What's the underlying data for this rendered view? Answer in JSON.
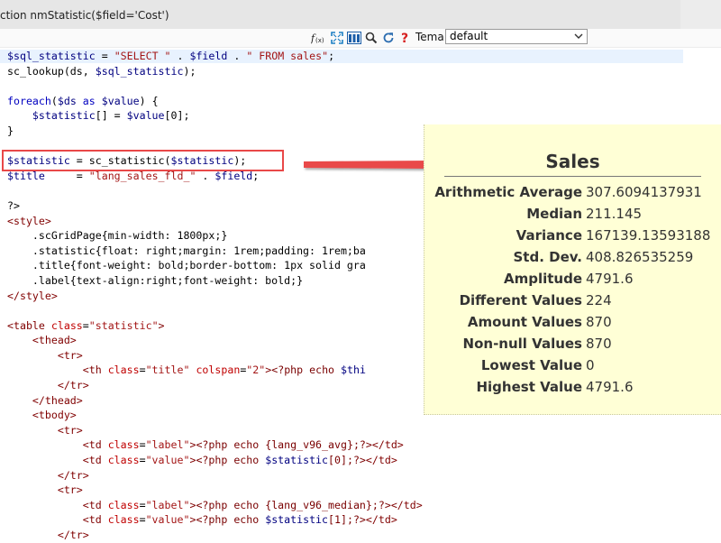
{
  "window": {
    "title": "ction nmStatistic($field='Cost')"
  },
  "toolbar": {
    "tema_label": "Tema",
    "tema_value": "default",
    "icons": [
      "fx-icon",
      "fullscreen-icon",
      "layout-icon",
      "search-icon",
      "refresh-icon",
      "help-icon"
    ]
  },
  "code_lines": [
    [
      {
        "t": "var",
        "v": "$sql_statistic"
      },
      {
        "t": "plain",
        "v": " = "
      },
      {
        "t": "str",
        "v": "\"SELECT \""
      },
      {
        "t": "plain",
        "v": " . "
      },
      {
        "t": "var",
        "v": "$field"
      },
      {
        "t": "plain",
        "v": " . "
      },
      {
        "t": "str",
        "v": "\" FROM sales\""
      },
      {
        "t": "plain",
        "v": ";"
      }
    ],
    [
      {
        "t": "plain",
        "v": "sc_lookup(ds, "
      },
      {
        "t": "var",
        "v": "$sql_statistic"
      },
      {
        "t": "plain",
        "v": ");"
      }
    ],
    [],
    [
      {
        "t": "kw",
        "v": "foreach"
      },
      {
        "t": "plain",
        "v": "("
      },
      {
        "t": "var",
        "v": "$ds"
      },
      {
        "t": "plain",
        "v": " "
      },
      {
        "t": "kw",
        "v": "as"
      },
      {
        "t": "plain",
        "v": " "
      },
      {
        "t": "var",
        "v": "$value"
      },
      {
        "t": "plain",
        "v": ") {"
      }
    ],
    [
      {
        "t": "plain",
        "v": "    "
      },
      {
        "t": "var",
        "v": "$statistic"
      },
      {
        "t": "plain",
        "v": "[] = "
      },
      {
        "t": "var",
        "v": "$value"
      },
      {
        "t": "plain",
        "v": "[0];"
      }
    ],
    [
      {
        "t": "plain",
        "v": "}"
      }
    ],
    [],
    [
      {
        "t": "var",
        "v": "$statistic"
      },
      {
        "t": "plain",
        "v": " = sc_statistic("
      },
      {
        "t": "var",
        "v": "$statistic"
      },
      {
        "t": "plain",
        "v": ");"
      }
    ],
    [
      {
        "t": "var",
        "v": "$title"
      },
      {
        "t": "plain",
        "v": "     = "
      },
      {
        "t": "str",
        "v": "\"lang_sales_fld_\""
      },
      {
        "t": "plain",
        "v": " . "
      },
      {
        "t": "var",
        "v": "$field"
      },
      {
        "t": "plain",
        "v": ";"
      }
    ],
    [],
    [
      {
        "t": "plain",
        "v": "?>"
      }
    ],
    [
      {
        "t": "tag",
        "v": "<style>"
      }
    ],
    [
      {
        "t": "plain",
        "v": "    .scGridPage{min-width: 1800px;}"
      }
    ],
    [
      {
        "t": "plain",
        "v": "    .statistic{float: right;margin: 1rem;padding: 1rem;ba"
      }
    ],
    [
      {
        "t": "plain",
        "v": "    .title{font-weight: bold;border-bottom: 1px solid gra"
      }
    ],
    [
      {
        "t": "plain",
        "v": "    .label{text-align:right;font-weight: bold;}"
      }
    ],
    [
      {
        "t": "tag",
        "v": "</style>"
      }
    ],
    [],
    [
      {
        "t": "tag",
        "v": "<table "
      },
      {
        "t": "attr",
        "v": "class"
      },
      {
        "t": "plain",
        "v": "="
      },
      {
        "t": "str",
        "v": "\"statistic\""
      },
      {
        "t": "tag",
        "v": ">"
      }
    ],
    [
      {
        "t": "plain",
        "v": "    "
      },
      {
        "t": "tag",
        "v": "<thead>"
      }
    ],
    [
      {
        "t": "plain",
        "v": "        "
      },
      {
        "t": "tag",
        "v": "<tr>"
      }
    ],
    [
      {
        "t": "plain",
        "v": "            "
      },
      {
        "t": "tag",
        "v": "<th "
      },
      {
        "t": "attr",
        "v": "class"
      },
      {
        "t": "plain",
        "v": "="
      },
      {
        "t": "str",
        "v": "\"title\""
      },
      {
        "t": "plain",
        "v": " "
      },
      {
        "t": "attr",
        "v": "colspan"
      },
      {
        "t": "plain",
        "v": "="
      },
      {
        "t": "str",
        "v": "\"2\""
      },
      {
        "t": "tag",
        "v": ">"
      },
      {
        "t": "php",
        "v": "<?php echo "
      },
      {
        "t": "var",
        "v": "$thi"
      }
    ],
    [
      {
        "t": "plain",
        "v": "        "
      },
      {
        "t": "tag",
        "v": "</tr>"
      }
    ],
    [
      {
        "t": "plain",
        "v": "    "
      },
      {
        "t": "tag",
        "v": "</thead>"
      }
    ],
    [
      {
        "t": "plain",
        "v": "    "
      },
      {
        "t": "tag",
        "v": "<tbody>"
      }
    ],
    [
      {
        "t": "plain",
        "v": "        "
      },
      {
        "t": "tag",
        "v": "<tr>"
      }
    ],
    [
      {
        "t": "plain",
        "v": "            "
      },
      {
        "t": "tag",
        "v": "<td "
      },
      {
        "t": "attr",
        "v": "class"
      },
      {
        "t": "plain",
        "v": "="
      },
      {
        "t": "str",
        "v": "\"label\""
      },
      {
        "t": "tag",
        "v": ">"
      },
      {
        "t": "php",
        "v": "<?php echo {lang_v96_avg};?>"
      },
      {
        "t": "tag",
        "v": "</td>"
      }
    ],
    [
      {
        "t": "plain",
        "v": "            "
      },
      {
        "t": "tag",
        "v": "<td "
      },
      {
        "t": "attr",
        "v": "class"
      },
      {
        "t": "plain",
        "v": "="
      },
      {
        "t": "str",
        "v": "\"value\""
      },
      {
        "t": "tag",
        "v": ">"
      },
      {
        "t": "php",
        "v": "<?php echo "
      },
      {
        "t": "var",
        "v": "$statistic"
      },
      {
        "t": "php",
        "v": "[0];?>"
      },
      {
        "t": "tag",
        "v": "</td>"
      }
    ],
    [
      {
        "t": "plain",
        "v": "        "
      },
      {
        "t": "tag",
        "v": "</tr>"
      }
    ],
    [
      {
        "t": "plain",
        "v": "        "
      },
      {
        "t": "tag",
        "v": "<tr>"
      }
    ],
    [
      {
        "t": "plain",
        "v": "            "
      },
      {
        "t": "tag",
        "v": "<td "
      },
      {
        "t": "attr",
        "v": "class"
      },
      {
        "t": "plain",
        "v": "="
      },
      {
        "t": "str",
        "v": "\"label\""
      },
      {
        "t": "tag",
        "v": ">"
      },
      {
        "t": "php",
        "v": "<?php echo {lang_v96_median};?>"
      },
      {
        "t": "tag",
        "v": "</td>"
      }
    ],
    [
      {
        "t": "plain",
        "v": "            "
      },
      {
        "t": "tag",
        "v": "<td "
      },
      {
        "t": "attr",
        "v": "class"
      },
      {
        "t": "plain",
        "v": "="
      },
      {
        "t": "str",
        "v": "\"value\""
      },
      {
        "t": "tag",
        "v": ">"
      },
      {
        "t": "php",
        "v": "<?php echo "
      },
      {
        "t": "var",
        "v": "$statistic"
      },
      {
        "t": "php",
        "v": "[1];?>"
      },
      {
        "t": "tag",
        "v": "</td>"
      }
    ],
    [
      {
        "t": "plain",
        "v": "        "
      },
      {
        "t": "tag",
        "v": "</tr>"
      }
    ]
  ],
  "stats_panel": {
    "title": "Sales",
    "rows": [
      {
        "label": "Arithmetic Average",
        "value": "307.6094137931"
      },
      {
        "label": "Median",
        "value": "211.145"
      },
      {
        "label": "Variance",
        "value": "167139.13593188"
      },
      {
        "label": "Std. Dev.",
        "value": "408.826535259"
      },
      {
        "label": "Amplitude",
        "value": "4791.6"
      },
      {
        "label": "Different Values",
        "value": "224"
      },
      {
        "label": "Amount Values",
        "value": "870"
      },
      {
        "label": "Non-null Values",
        "value": "870"
      },
      {
        "label": "Lowest Value",
        "value": "0"
      },
      {
        "label": "Highest Value",
        "value": "4791.6"
      }
    ]
  },
  "colors": {
    "highlight_box": "#e94848",
    "arrow": "#e94848",
    "panel_bg": "#ffffd6"
  }
}
